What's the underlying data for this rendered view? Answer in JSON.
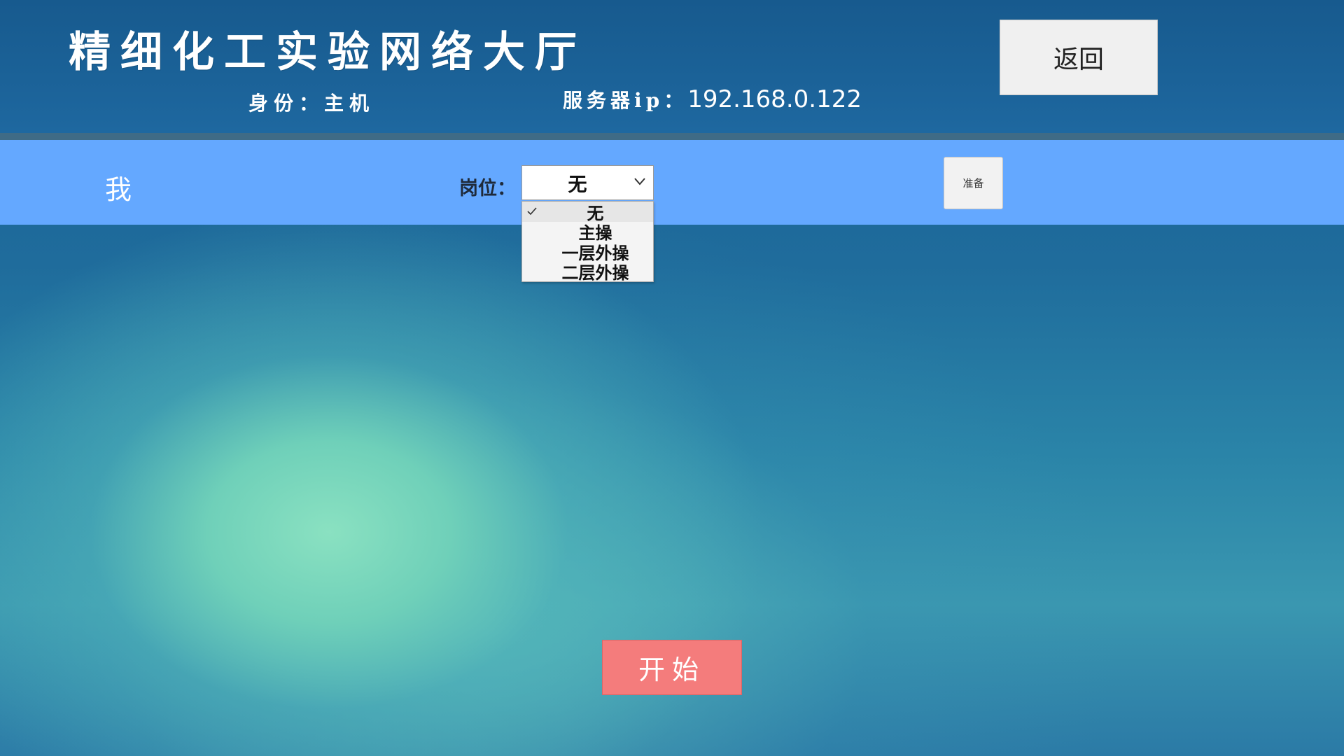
{
  "header": {
    "title": "精细化工实验网络大厅",
    "identity": "身份：主机",
    "server_ip_label": "服务器ip：",
    "server_ip_value": "192.168.0.122",
    "back_label": "返回"
  },
  "player_row": {
    "name": "我",
    "role_label": "岗位：",
    "role_selected": "无",
    "ready_label": "准备",
    "background_color": "#64a8ff"
  },
  "role_dropdown": {
    "options": [
      "无",
      "主操",
      "一层外操",
      "二层外操"
    ],
    "selected_index": 0
  },
  "start_button": {
    "label": "开始",
    "color": "#f47c7c"
  },
  "icons": {
    "select_arrow": "chevron-down-icon",
    "selected_mark": "check-icon"
  }
}
